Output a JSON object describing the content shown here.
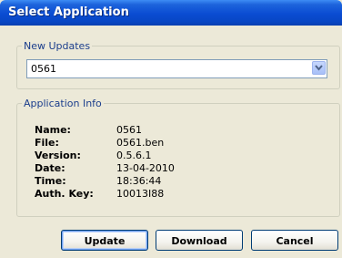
{
  "window": {
    "title": "Select Application"
  },
  "updates": {
    "legend": "New Updates",
    "selected": "0561"
  },
  "info": {
    "legend": "Application Info",
    "rows": [
      {
        "label": "Name:",
        "value": "0561"
      },
      {
        "label": "File:",
        "value": "0561.ben"
      },
      {
        "label": "Version:",
        "value": "0.5.6.1"
      },
      {
        "label": "Date:",
        "value": "13-04-2010"
      },
      {
        "label": "Time:",
        "value": "18:36:44"
      },
      {
        "label": "Auth. Key:",
        "value": "10013I88"
      }
    ]
  },
  "buttons": {
    "update": "Update",
    "download": "Download",
    "cancel": "Cancel"
  },
  "icons": {
    "dropdown": "chevron-down-icon"
  },
  "colors": {
    "titlebar": "#0a4cd2",
    "window_bg": "#ece9d8",
    "group_legend": "#1b3e8c"
  }
}
